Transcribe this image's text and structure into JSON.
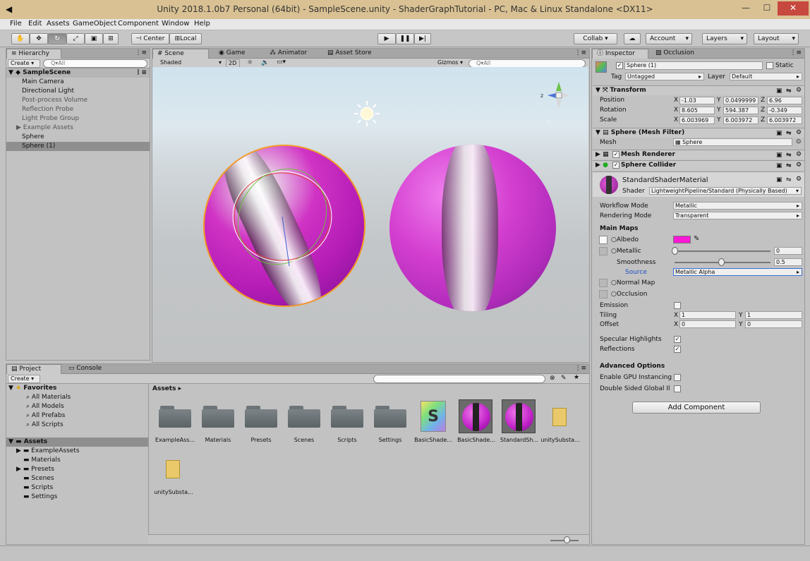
{
  "window": {
    "title": "Unity 2018.1.0b7 Personal (64bit) - SampleScene.unity - ShaderGraphTutorial - PC, Mac & Linux Standalone <DX11>",
    "minimize": "—",
    "maximize": "☐",
    "close": "✕"
  },
  "menu": [
    "File",
    "Edit",
    "Assets",
    "GameObject",
    "Component",
    "Window",
    "Help"
  ],
  "toolbar": {
    "center": "Center",
    "local": "Local",
    "collab": "Collab ▾",
    "account": "Account",
    "layers": "Layers",
    "layout": "Layout"
  },
  "hierarchy": {
    "tab": "Hierarchy",
    "create": "Create ▾",
    "search": "Q▾All",
    "scene": "SampleScene",
    "items": [
      "Main Camera",
      "Directional Light",
      "Post-process Volume",
      "Reflection Probe",
      "Light Probe Group",
      "Example Assets",
      "Sphere",
      "Sphere (1)"
    ]
  },
  "scene": {
    "tabs": [
      "Scene",
      "Game",
      "Animator",
      "Asset Store"
    ],
    "shading": "Shaded",
    "mode2d": "2D",
    "gizmos": "Gizmos ▾",
    "search": "Q▾All"
  },
  "project": {
    "tabs": [
      "Project",
      "Console"
    ],
    "create": "Create ▾",
    "favorites": "Favorites",
    "fav_items": [
      "All Materials",
      "All Models",
      "All Prefabs",
      "All Scripts"
    ],
    "assets_root": "Assets",
    "tree": [
      "ExampleAssets",
      "Materials",
      "Presets",
      "Scenes",
      "Scripts",
      "Settings"
    ],
    "breadcrumb": "Assets ▸",
    "grid": [
      "ExampleAss...",
      "Materials",
      "Presets",
      "Scenes",
      "Scripts",
      "Settings",
      "BasicShade...",
      "BasicShade...",
      "StandardSh...",
      "unitySubsta...",
      "unitySubsta..."
    ]
  },
  "inspector": {
    "tabs": [
      "Inspector",
      "Occlusion"
    ],
    "name": "Sphere (1)",
    "static": "Static",
    "tag_label": "Tag",
    "tag": "Untagged",
    "layer_label": "Layer",
    "layer": "Default",
    "transform": {
      "title": "Transform",
      "pos_label": "Position",
      "rot_label": "Rotation",
      "scale_label": "Scale",
      "pos": [
        "-1.03",
        "0.0499999",
        "6.96"
      ],
      "rot": [
        "8.605",
        "594.387",
        "-0.349"
      ],
      "scale": [
        "6.003969",
        "6.003972",
        "6.003972"
      ]
    },
    "mesh_filter": {
      "title": "Sphere (Mesh Filter)",
      "mesh_label": "Mesh",
      "mesh": "Sphere"
    },
    "mesh_renderer": "Mesh Renderer",
    "collider": "Sphere Collider",
    "material": {
      "name": "StandardShaderMaterial",
      "shader_label": "Shader",
      "shader": "LightweightPipeline/Standard (Physically Based)"
    },
    "props": {
      "workflow_label": "Workflow Mode",
      "workflow": "Metallic",
      "render_label": "Rendering Mode",
      "render": "Transparent",
      "main_maps": "Main Maps",
      "albedo": "Albedo",
      "metallic": "Metallic",
      "metallic_val": "0",
      "smoothness": "Smoothness",
      "smooth_val": "0.5",
      "source_label": "Source",
      "source": "Metallic Alpha",
      "normal": "Normal Map",
      "occlusion": "Occlusion",
      "emission": "Emission",
      "tiling": "Tiling",
      "offset": "Offset",
      "tiling_x": "1",
      "tiling_y": "1",
      "offset_x": "0",
      "offset_y": "0",
      "spec": "Specular Highlights",
      "refl": "Reflections",
      "advanced": "Advanced Options",
      "gpu": "Enable GPU Instancing",
      "dsgi": "Double Sided Global Il"
    },
    "add_component": "Add Component"
  },
  "colors": {
    "albedo": "#ff18d6",
    "selection": "#8f8f8f"
  }
}
